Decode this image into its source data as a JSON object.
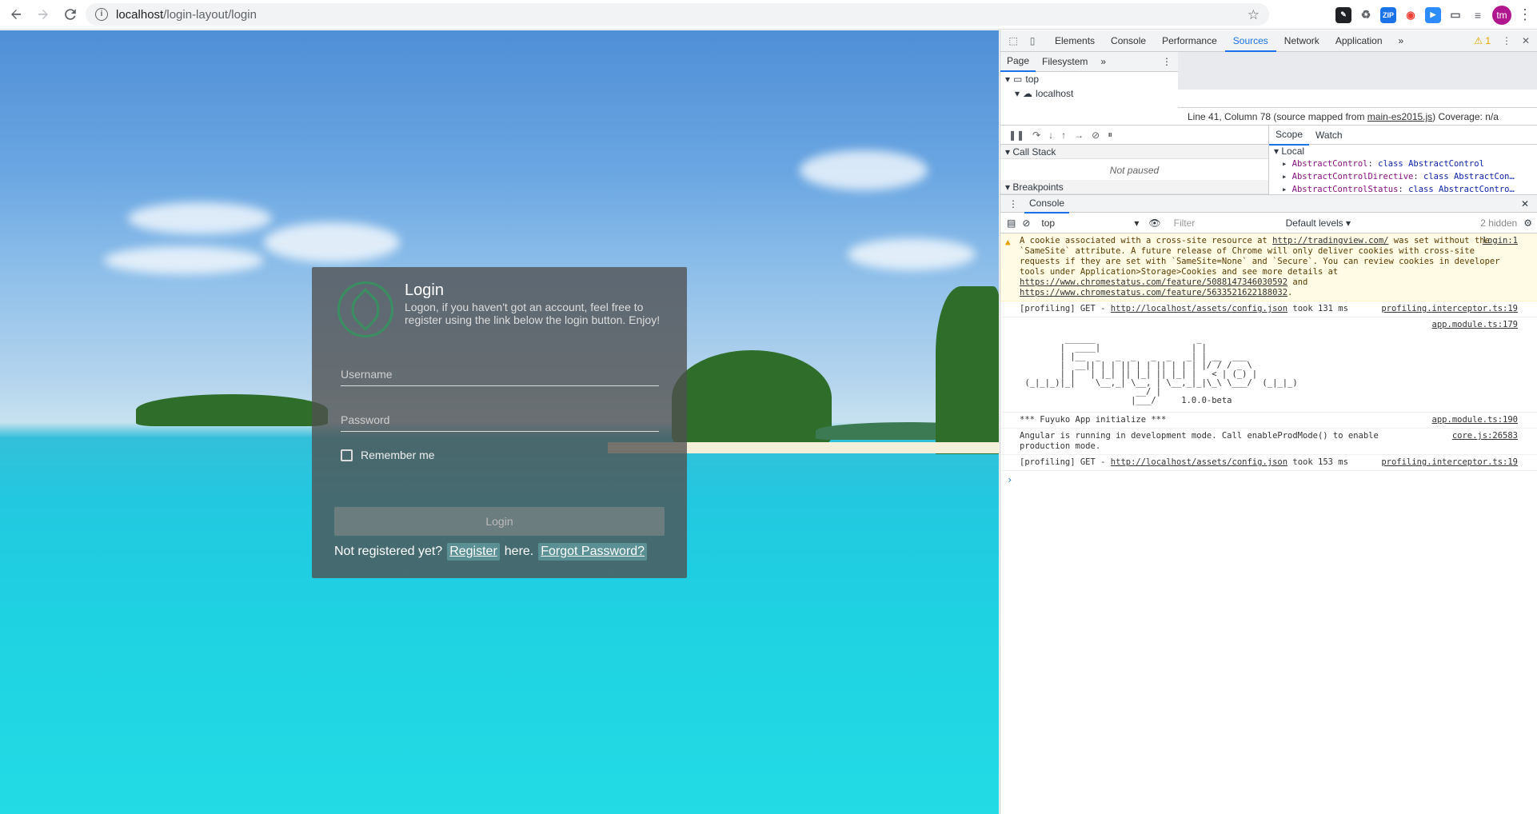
{
  "browser": {
    "url_host": "localhost",
    "url_path": "/login-layout/login",
    "avatar_initials": "tm",
    "extensions": [
      {
        "name": "pen-ext",
        "color": "#202124",
        "label": ""
      },
      {
        "name": "recycle-ext",
        "color": "#5f6368",
        "label": ""
      },
      {
        "name": "zip-ext",
        "color": "#1a73e8",
        "label": "ZIP"
      },
      {
        "name": "record-ext",
        "color": "#ea4335",
        "label": ""
      },
      {
        "name": "zoom-ext",
        "color": "#2d8cff",
        "label": ""
      }
    ]
  },
  "login": {
    "title": "Login",
    "subtitle": "Logon, if you haven't got an account, feel free to register using the link below the login button. Enjoy!",
    "username_placeholder": "Username",
    "password_placeholder": "Password",
    "remember_label": "Remember me",
    "login_button": "Login",
    "not_registered": "Not registered yet?",
    "register_link": "Register",
    "here": "here.",
    "forgot_link": "Forgot Password?"
  },
  "devtools": {
    "tabs": [
      "Elements",
      "Console",
      "Performance",
      "Sources",
      "Network",
      "Application"
    ],
    "active_tab": "Sources",
    "more": "»",
    "warnings": "1",
    "sources_subtabs": [
      "Page",
      "Filesystem"
    ],
    "tree": [
      {
        "label": "top"
      },
      {
        "label": "localhost"
      }
    ],
    "status_prefix": "Line 41, Column 78  (source mapped from ",
    "status_file": "main-es2015.js",
    "status_suffix": ")  Coverage: n/a",
    "call_stack_label": "Call Stack",
    "not_paused": "Not paused",
    "breakpoints_label": "Breakpoints",
    "scope_tabs": [
      "Scope",
      "Watch"
    ],
    "scope_local": "Local",
    "scope_rows": [
      {
        "key": "AbstractControl",
        "value": "class AbstractControl"
      },
      {
        "key": "AbstractControlDirective",
        "value": "class AbstractCon…"
      },
      {
        "key": "AbstractControlStatus",
        "value": "class AbstractContro…"
      }
    ],
    "drawer_tab": "Console",
    "context": "top",
    "filter_placeholder": "Filter",
    "levels": "Default levels",
    "hidden": "2 hidden"
  },
  "console": {
    "warning_text_1": "A cookie associated with a cross-site resource at ",
    "warning_link_1": "http://tradingview.com/",
    "warning_text_2": " was set without the `SameSite` attribute. A future release of Chrome will only deliver cookies with cross-site requests if they are set with `SameSite=None` and `Secure`. You can review cookies in developer tools under Application>Storage>Cookies and see more details at ",
    "warning_link_2": "https://www.chromestatus.com/feature/5088147346030592",
    "warning_text_3": " and ",
    "warning_link_3": "https://www.chromestatus.com/feature/5633521622188032",
    "warning_text_4": ".",
    "warning_src": "login:1",
    "profiling1_prefix": "[profiling] GET - ",
    "profiling1_link": "http://localhost/assets/config.json",
    "profiling1_suffix": " took 131 ms",
    "profiling1_src": "profiling.interceptor.ts:19",
    "ascii_src": "app.module.ts:179",
    "ascii_art": "         ______                    _\n        |  ____|                  | |\n        | |__  _   _  _   _  _   _| | __  ___\n        |  __|| | | || | | || | | | |/ / / _ \\\n        | |   | |_| || |_| || |_| |   < | (_) |\n (_|_|_)|_|    \\__,_| \\__, | \\__,_|_|\\_\\ \\___/  (_|_|_)\n                       __/ |\n                      |___/     1.0.0-beta",
    "init_text": "*** Fuyuko App initialize ***",
    "init_src": "app.module.ts:190",
    "angular_text": "Angular is running in development mode. Call enableProdMode() to enable production mode.",
    "angular_src": "core.js:26583",
    "profiling2_prefix": "[profiling] GET - ",
    "profiling2_link": "http://localhost/assets/config.json",
    "profiling2_suffix": " took 153 ms",
    "profiling2_src": "profiling.interceptor.ts:19",
    "prompt": "›"
  }
}
